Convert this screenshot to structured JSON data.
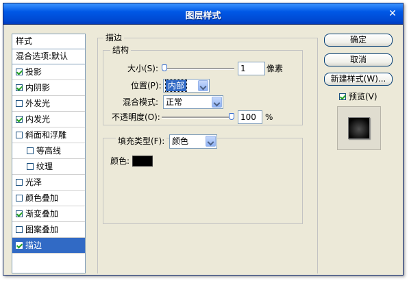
{
  "window": {
    "title": "图层样式",
    "close_glyph": "✕"
  },
  "styles_panel": {
    "header": "样式",
    "blend_options": "混合选项:默认",
    "items": [
      {
        "label": "投影",
        "checked": true,
        "sub": false,
        "selected": false
      },
      {
        "label": "内阴影",
        "checked": true,
        "sub": false,
        "selected": false
      },
      {
        "label": "外发光",
        "checked": false,
        "sub": false,
        "selected": false
      },
      {
        "label": "内发光",
        "checked": true,
        "sub": false,
        "selected": false
      },
      {
        "label": "斜面和浮雕",
        "checked": false,
        "sub": false,
        "selected": false
      },
      {
        "label": "等高线",
        "checked": false,
        "sub": true,
        "selected": false
      },
      {
        "label": "纹理",
        "checked": false,
        "sub": true,
        "selected": false
      },
      {
        "label": "光泽",
        "checked": false,
        "sub": false,
        "selected": false
      },
      {
        "label": "颜色叠加",
        "checked": false,
        "sub": false,
        "selected": false
      },
      {
        "label": "渐变叠加",
        "checked": true,
        "sub": false,
        "selected": false
      },
      {
        "label": "图案叠加",
        "checked": false,
        "sub": false,
        "selected": false
      },
      {
        "label": "描边",
        "checked": true,
        "sub": false,
        "selected": true
      }
    ]
  },
  "stroke": {
    "group_title": "描边",
    "structure": {
      "group_title": "结构",
      "size_label": "大小(S):",
      "size_value": "1",
      "size_unit": "像素",
      "position_label": "位置(P):",
      "position_value": "内部",
      "blend_mode_label": "混合模式:",
      "blend_mode_value": "正常",
      "opacity_label": "不透明度(O):",
      "opacity_value": "100",
      "opacity_unit": "%",
      "size_slider_fraction": 0.0,
      "opacity_slider_fraction": 1.0
    },
    "fill": {
      "fill_type_label": "填充类型(F):",
      "fill_type_value": "颜色",
      "color_label": "颜色:",
      "color_value": "#000000"
    }
  },
  "buttons": {
    "ok": "确定",
    "cancel": "取消",
    "new_style": "新建样式(W)...",
    "preview_label": "预览(V)",
    "preview_checked": true
  },
  "colors": {
    "title_bar": "#0058e6",
    "selected_item": "#316ac5",
    "dialog_bg": "#ece9d8"
  },
  "icons": {
    "close": "close-icon",
    "dropdown": "chevron-down-icon",
    "slider_thumb": "slider-thumb-icon"
  }
}
